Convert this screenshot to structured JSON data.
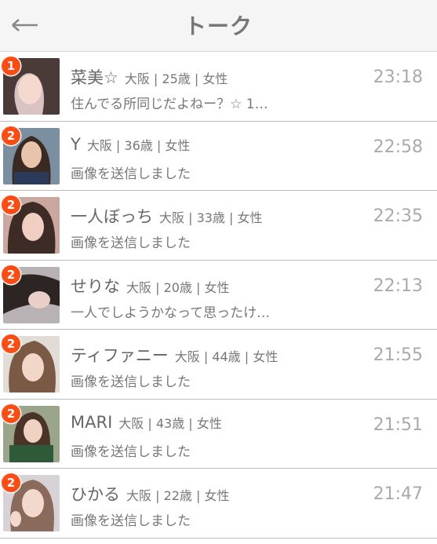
{
  "header": {
    "title": "トーク",
    "back_icon": "left-arrow-icon"
  },
  "badge_color": "#ff4c12",
  "chats": [
    {
      "badge": "1",
      "name": "菜美☆",
      "meta": "大阪 | 25歳 | 女性",
      "message": "住んでる所同じだよねー？☆ 1…",
      "time": "23:18"
    },
    {
      "badge": "2",
      "name": "Y",
      "meta": "大阪 | 36歳 | 女性",
      "message": "画像を送信しました",
      "time": "22:58"
    },
    {
      "badge": "2",
      "name": "一人ぼっち",
      "meta": "大阪 | 33歳 | 女性",
      "message": "画像を送信しました",
      "time": "22:35"
    },
    {
      "badge": "2",
      "name": "せりな",
      "meta": "大阪 | 20歳 | 女性",
      "message": "一人でしようかなって思ったけ…",
      "time": "22:13"
    },
    {
      "badge": "2",
      "name": "ティファニー",
      "meta": "大阪 | 44歳 | 女性",
      "message": "画像を送信しました",
      "time": "21:55"
    },
    {
      "badge": "2",
      "name": "MARI",
      "meta": "大阪 | 43歳 | 女性",
      "message": "画像を送信しました",
      "time": "21:51"
    },
    {
      "badge": "2",
      "name": "ひかる",
      "meta": "大阪 | 22歳 | 女性",
      "message": "画像を送信しました",
      "time": "21:47"
    }
  ]
}
